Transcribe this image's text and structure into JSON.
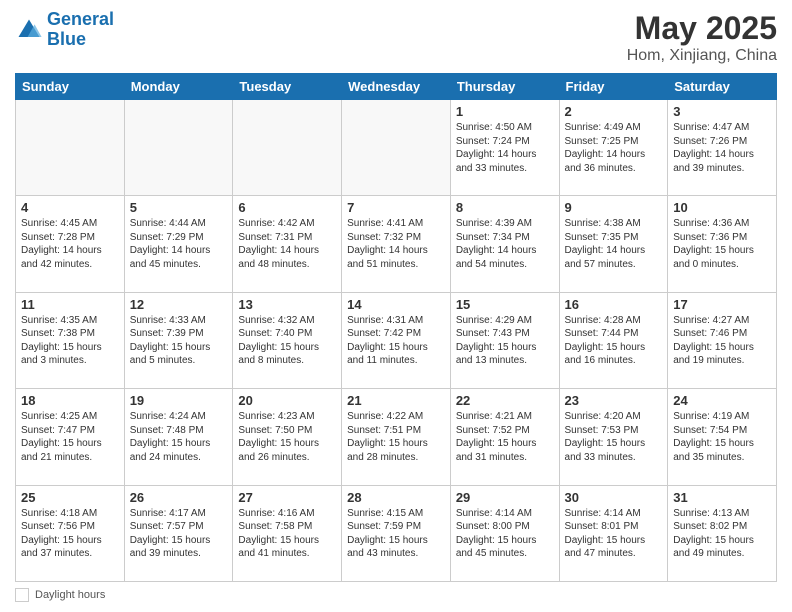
{
  "header": {
    "logo_general": "General",
    "logo_blue": "Blue",
    "title": "May 2025",
    "subtitle": "Hom, Xinjiang, China"
  },
  "footer": {
    "daylight_label": "Daylight hours"
  },
  "weekdays": [
    "Sunday",
    "Monday",
    "Tuesday",
    "Wednesday",
    "Thursday",
    "Friday",
    "Saturday"
  ],
  "weeks": [
    [
      {
        "day": "",
        "info": ""
      },
      {
        "day": "",
        "info": ""
      },
      {
        "day": "",
        "info": ""
      },
      {
        "day": "",
        "info": ""
      },
      {
        "day": "1",
        "info": "Sunrise: 4:50 AM\nSunset: 7:24 PM\nDaylight: 14 hours and 33 minutes."
      },
      {
        "day": "2",
        "info": "Sunrise: 4:49 AM\nSunset: 7:25 PM\nDaylight: 14 hours and 36 minutes."
      },
      {
        "day": "3",
        "info": "Sunrise: 4:47 AM\nSunset: 7:26 PM\nDaylight: 14 hours and 39 minutes."
      }
    ],
    [
      {
        "day": "4",
        "info": "Sunrise: 4:45 AM\nSunset: 7:28 PM\nDaylight: 14 hours and 42 minutes."
      },
      {
        "day": "5",
        "info": "Sunrise: 4:44 AM\nSunset: 7:29 PM\nDaylight: 14 hours and 45 minutes."
      },
      {
        "day": "6",
        "info": "Sunrise: 4:42 AM\nSunset: 7:31 PM\nDaylight: 14 hours and 48 minutes."
      },
      {
        "day": "7",
        "info": "Sunrise: 4:41 AM\nSunset: 7:32 PM\nDaylight: 14 hours and 51 minutes."
      },
      {
        "day": "8",
        "info": "Sunrise: 4:39 AM\nSunset: 7:34 PM\nDaylight: 14 hours and 54 minutes."
      },
      {
        "day": "9",
        "info": "Sunrise: 4:38 AM\nSunset: 7:35 PM\nDaylight: 14 hours and 57 minutes."
      },
      {
        "day": "10",
        "info": "Sunrise: 4:36 AM\nSunset: 7:36 PM\nDaylight: 15 hours and 0 minutes."
      }
    ],
    [
      {
        "day": "11",
        "info": "Sunrise: 4:35 AM\nSunset: 7:38 PM\nDaylight: 15 hours and 3 minutes."
      },
      {
        "day": "12",
        "info": "Sunrise: 4:33 AM\nSunset: 7:39 PM\nDaylight: 15 hours and 5 minutes."
      },
      {
        "day": "13",
        "info": "Sunrise: 4:32 AM\nSunset: 7:40 PM\nDaylight: 15 hours and 8 minutes."
      },
      {
        "day": "14",
        "info": "Sunrise: 4:31 AM\nSunset: 7:42 PM\nDaylight: 15 hours and 11 minutes."
      },
      {
        "day": "15",
        "info": "Sunrise: 4:29 AM\nSunset: 7:43 PM\nDaylight: 15 hours and 13 minutes."
      },
      {
        "day": "16",
        "info": "Sunrise: 4:28 AM\nSunset: 7:44 PM\nDaylight: 15 hours and 16 minutes."
      },
      {
        "day": "17",
        "info": "Sunrise: 4:27 AM\nSunset: 7:46 PM\nDaylight: 15 hours and 19 minutes."
      }
    ],
    [
      {
        "day": "18",
        "info": "Sunrise: 4:25 AM\nSunset: 7:47 PM\nDaylight: 15 hours and 21 minutes."
      },
      {
        "day": "19",
        "info": "Sunrise: 4:24 AM\nSunset: 7:48 PM\nDaylight: 15 hours and 24 minutes."
      },
      {
        "day": "20",
        "info": "Sunrise: 4:23 AM\nSunset: 7:50 PM\nDaylight: 15 hours and 26 minutes."
      },
      {
        "day": "21",
        "info": "Sunrise: 4:22 AM\nSunset: 7:51 PM\nDaylight: 15 hours and 28 minutes."
      },
      {
        "day": "22",
        "info": "Sunrise: 4:21 AM\nSunset: 7:52 PM\nDaylight: 15 hours and 31 minutes."
      },
      {
        "day": "23",
        "info": "Sunrise: 4:20 AM\nSunset: 7:53 PM\nDaylight: 15 hours and 33 minutes."
      },
      {
        "day": "24",
        "info": "Sunrise: 4:19 AM\nSunset: 7:54 PM\nDaylight: 15 hours and 35 minutes."
      }
    ],
    [
      {
        "day": "25",
        "info": "Sunrise: 4:18 AM\nSunset: 7:56 PM\nDaylight: 15 hours and 37 minutes."
      },
      {
        "day": "26",
        "info": "Sunrise: 4:17 AM\nSunset: 7:57 PM\nDaylight: 15 hours and 39 minutes."
      },
      {
        "day": "27",
        "info": "Sunrise: 4:16 AM\nSunset: 7:58 PM\nDaylight: 15 hours and 41 minutes."
      },
      {
        "day": "28",
        "info": "Sunrise: 4:15 AM\nSunset: 7:59 PM\nDaylight: 15 hours and 43 minutes."
      },
      {
        "day": "29",
        "info": "Sunrise: 4:14 AM\nSunset: 8:00 PM\nDaylight: 15 hours and 45 minutes."
      },
      {
        "day": "30",
        "info": "Sunrise: 4:14 AM\nSunset: 8:01 PM\nDaylight: 15 hours and 47 minutes."
      },
      {
        "day": "31",
        "info": "Sunrise: 4:13 AM\nSunset: 8:02 PM\nDaylight: 15 hours and 49 minutes."
      }
    ]
  ]
}
